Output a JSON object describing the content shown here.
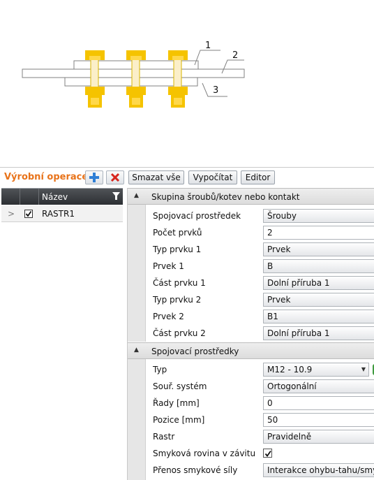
{
  "preview": {
    "callouts": [
      "1",
      "2",
      "3"
    ]
  },
  "toolbar": {
    "title": "Výrobní operace",
    "add_icon": "add-icon",
    "delete_icon": "delete-icon",
    "clear_all_label": "Smazat vše",
    "calculate_label": "Vypočítat",
    "editor_label": "Editor"
  },
  "operations_grid": {
    "column_name": "Název",
    "rows": [
      {
        "checked": true,
        "name": "RASTR1"
      }
    ]
  },
  "properties": {
    "group1": {
      "title": "Skupina šroubů/kotev nebo kontakt",
      "rows": [
        {
          "label": "Spojovací prostředek",
          "value": "Šrouby",
          "type": "select"
        },
        {
          "label": "Počet prvků",
          "value": "2",
          "type": "input"
        },
        {
          "label": "Typ prvku 1",
          "value": "Prvek",
          "type": "select"
        },
        {
          "label": "Prvek 1",
          "value": "B",
          "type": "select"
        },
        {
          "label": "Část prvku 1",
          "value": "Dolní příruba 1",
          "type": "select"
        },
        {
          "label": "Typ prvku 2",
          "value": "Prvek",
          "type": "select"
        },
        {
          "label": "Prvek 2",
          "value": "B1",
          "type": "select"
        },
        {
          "label": "Část prvku 2",
          "value": "Dolní příruba 1",
          "type": "select"
        }
      ]
    },
    "group2": {
      "title": "Spojovací prostředky",
      "rows": [
        {
          "label": "Typ",
          "value": "M12 - 10.9",
          "type": "select"
        },
        {
          "label": "Souř. systém",
          "value": "Ortogonální",
          "type": "select"
        },
        {
          "label": "Řady [mm]",
          "value": "0",
          "type": "input"
        },
        {
          "label": "Pozice [mm]",
          "value": "50",
          "type": "input"
        },
        {
          "label": "Rastr",
          "value": "Pravidelně",
          "type": "select"
        },
        {
          "label": "Smyková rovina v závitu",
          "checked": true,
          "type": "checkbox"
        },
        {
          "label": "Přenos smykové síly",
          "value": "Interakce ohybu-tahu/smyku",
          "type": "select"
        }
      ]
    }
  },
  "colors": {
    "accent_title": "#e8731a",
    "bolt_yellow": "#f5c300",
    "bolt_shank": "#fbefc9",
    "header_dark": "#3a3d41"
  }
}
